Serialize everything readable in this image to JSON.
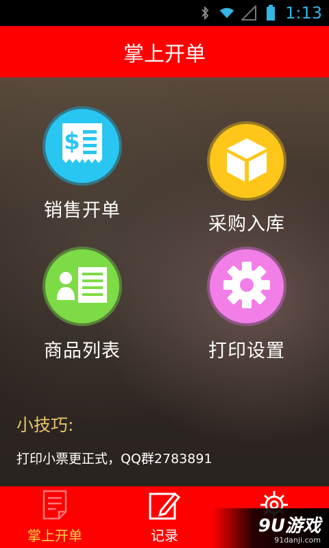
{
  "status_bar": {
    "time": "1:13",
    "icons": [
      "bluetooth-icon",
      "wifi-icon",
      "signal-icon",
      "battery-icon"
    ]
  },
  "header": {
    "title": "掌上开单"
  },
  "menu": {
    "tiles": [
      {
        "label": "销售开单",
        "icon": "receipt-dollar-icon",
        "color": "#29c6f2"
      },
      {
        "label": "采购入库",
        "icon": "box-icon",
        "color": "#ffc61a"
      },
      {
        "label": "商品列表",
        "icon": "contact-list-icon",
        "color": "#7ddc45"
      },
      {
        "label": "打印设置",
        "icon": "gear-icon",
        "color": "#f27ee8"
      }
    ]
  },
  "tips": {
    "title": "小技巧:",
    "text": "打印小票更正式，QQ群2783891"
  },
  "bottom_nav": {
    "items": [
      {
        "label": "掌上开单",
        "icon": "document-icon",
        "active": true
      },
      {
        "label": "记录",
        "icon": "edit-icon",
        "active": false
      },
      {
        "label": "",
        "icon": "gear-outline-icon",
        "active": false
      }
    ]
  },
  "watermark": {
    "main": "9U游戏",
    "sub": "91danji.com"
  },
  "colors": {
    "brand_red": "#ff0000",
    "tip_yellow": "#e9c46a",
    "active_tab": "#ffd84a",
    "clock_blue": "#33b5e5"
  }
}
